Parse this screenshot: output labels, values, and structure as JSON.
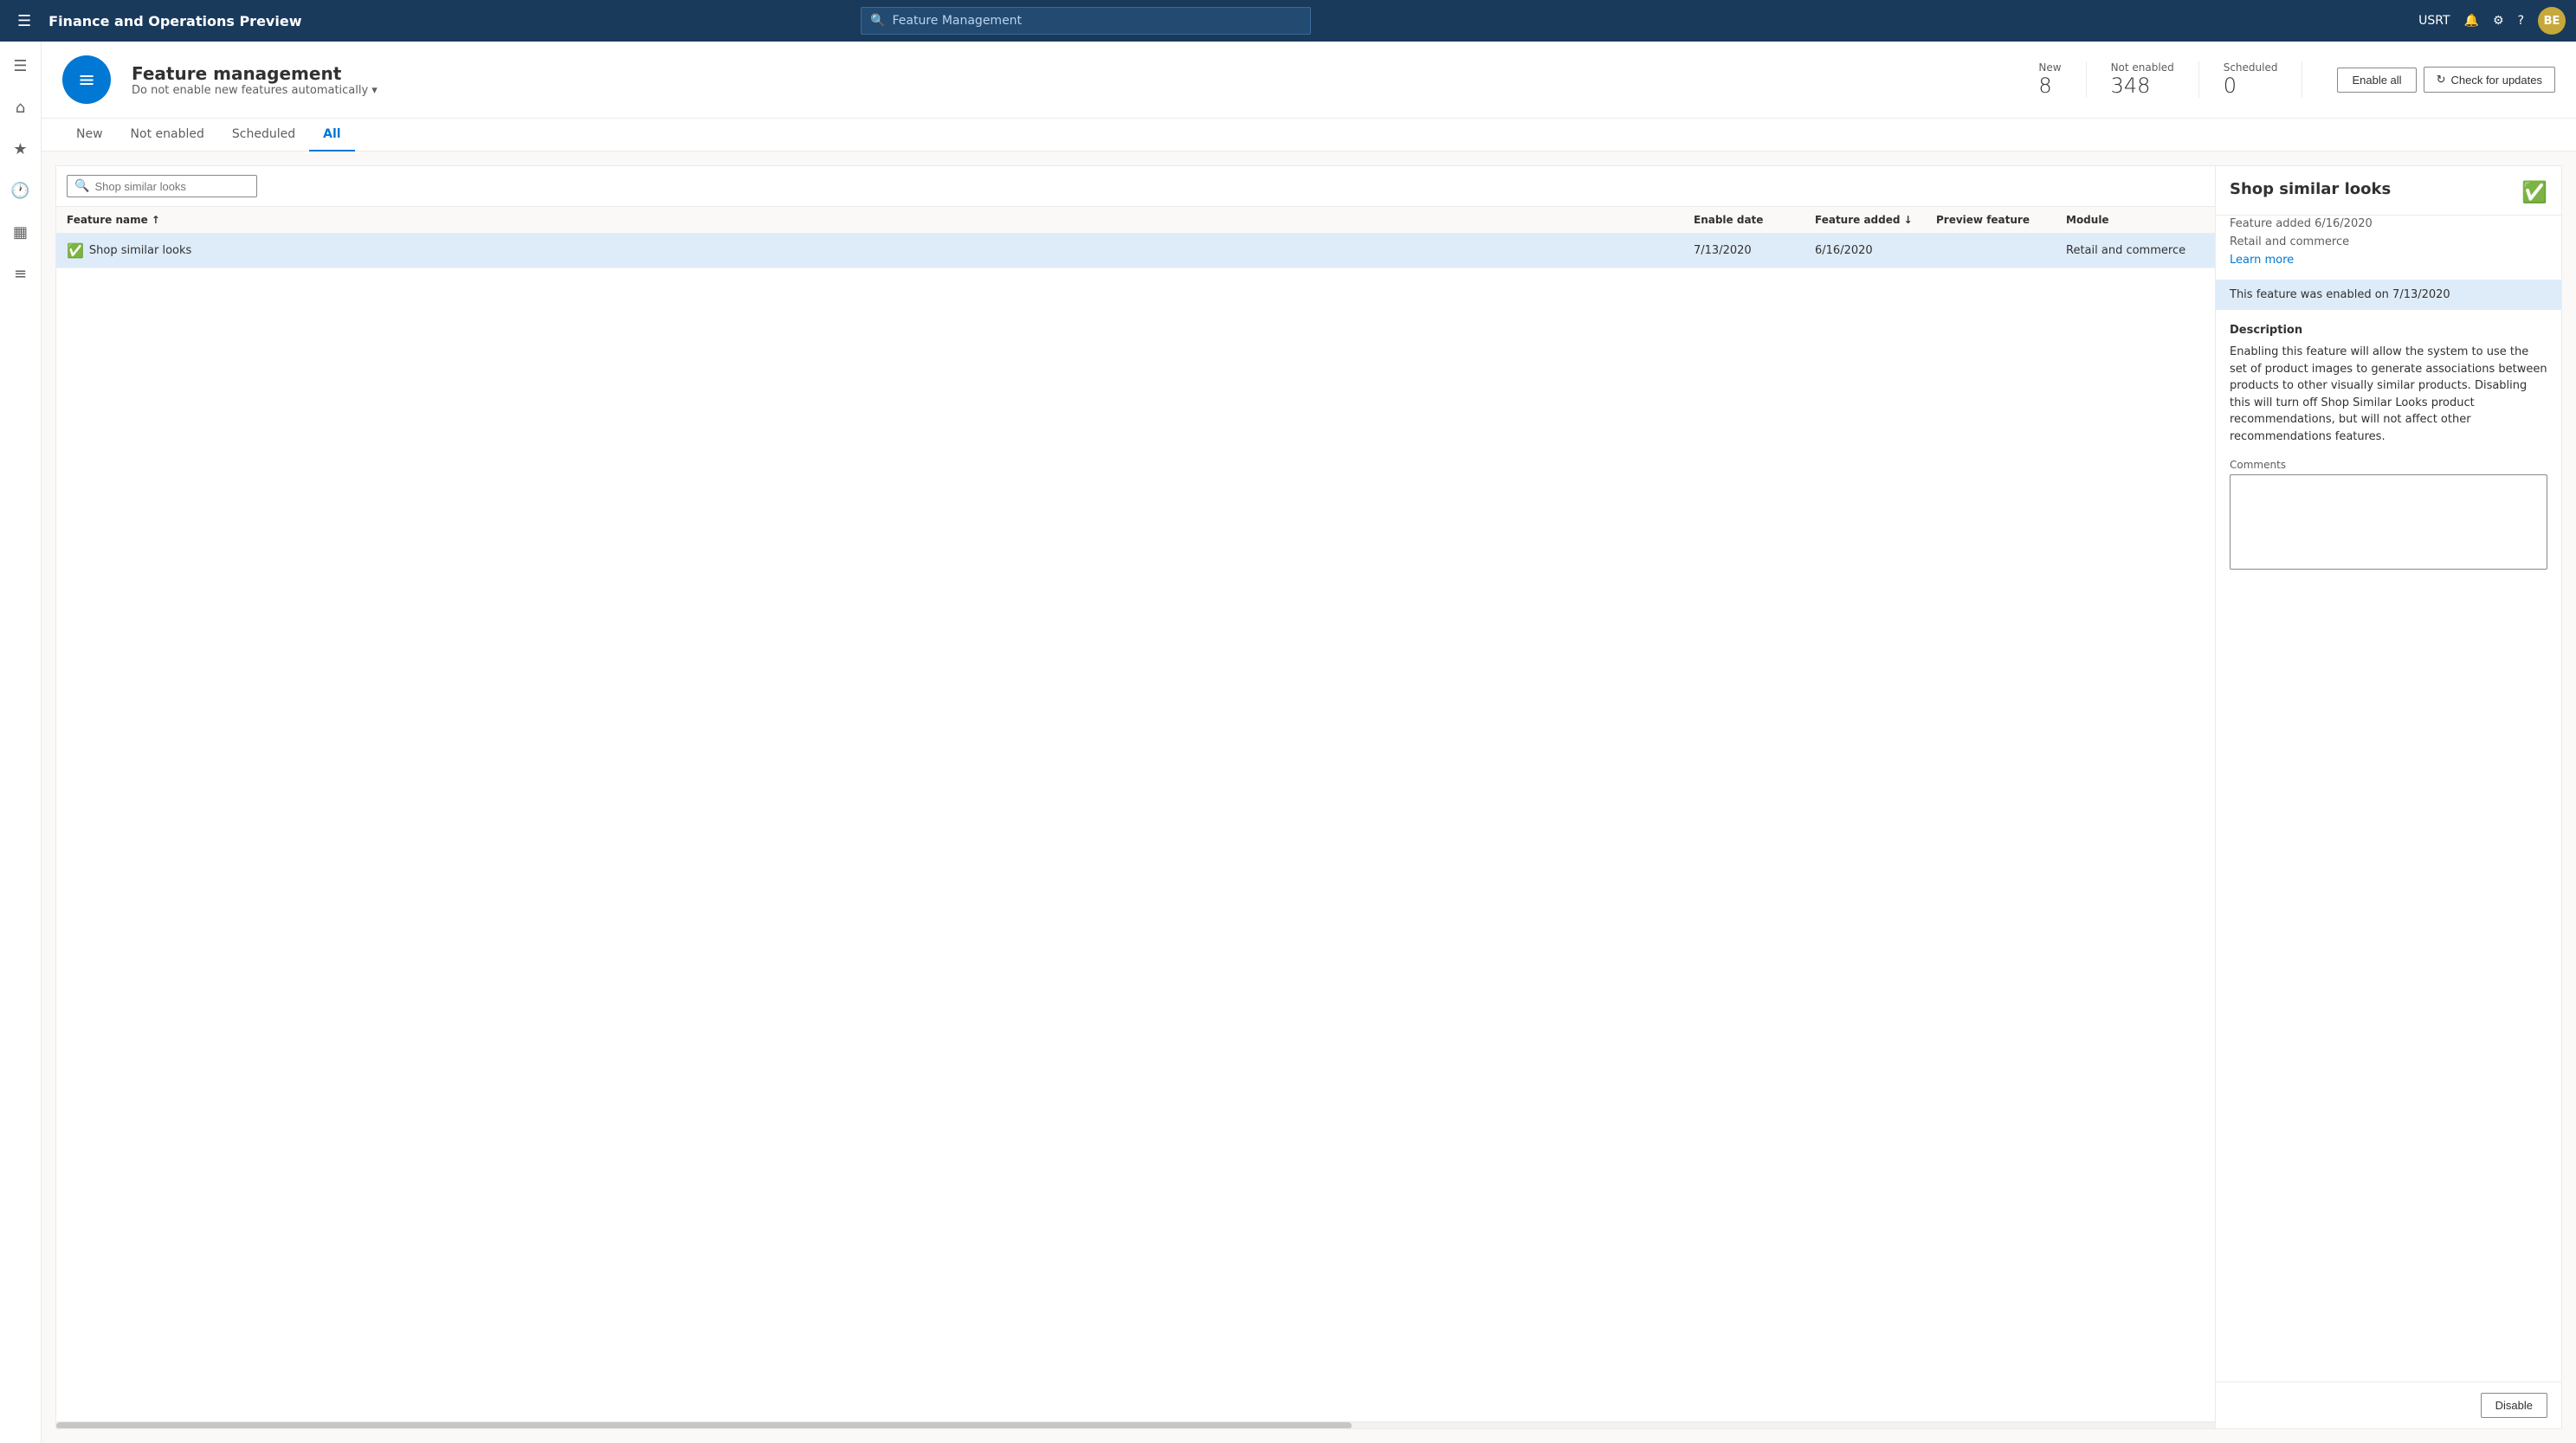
{
  "topbar": {
    "title": "Finance and Operations Preview",
    "search_placeholder": "Feature Management",
    "user_label": "USRT",
    "avatar_initials": "BE"
  },
  "page_header": {
    "icon_label": "list-icon",
    "title": "Feature management",
    "subtitle": "Do not enable new features automatically",
    "stats": [
      {
        "label": "New",
        "value": "8"
      },
      {
        "label": "Not enabled",
        "value": "348"
      },
      {
        "label": "Scheduled",
        "value": "0"
      }
    ],
    "btn_enable_all": "Enable all",
    "btn_check_updates": "Check for updates"
  },
  "tabs": [
    {
      "label": "New",
      "active": false
    },
    {
      "label": "Not enabled",
      "active": false
    },
    {
      "label": "Scheduled",
      "active": false
    },
    {
      "label": "All",
      "active": true
    }
  ],
  "table": {
    "search_placeholder": "Shop similar looks",
    "columns": [
      {
        "label": "Feature name",
        "sortable": true,
        "sort_dir": "asc"
      },
      {
        "label": "Enable date",
        "sortable": false
      },
      {
        "label": "Feature added",
        "sortable": true,
        "sort_dir": "desc"
      },
      {
        "label": "Preview feature",
        "sortable": false
      },
      {
        "label": "Module",
        "sortable": false
      }
    ],
    "rows": [
      {
        "name": "Shop similar looks",
        "enabled": true,
        "enable_date": "7/13/2020",
        "feature_added": "6/16/2020",
        "preview_feature": "",
        "module": "Retail and commerce",
        "selected": true
      }
    ]
  },
  "detail": {
    "title": "Shop similar looks",
    "feature_added": "Feature added 6/16/2020",
    "module": "Retail and commerce",
    "learn_more_label": "Learn more",
    "enabled_banner": "This feature was enabled on 7/13/2020",
    "description_title": "Description",
    "description": "Enabling this feature will allow the system to use the set of product images to generate associations between products to other visually similar products. Disabling this will turn off Shop Similar Looks product recommendations, but will not affect other recommendations features.",
    "comments_label": "Comments",
    "comments_value": "",
    "btn_disable": "Disable"
  },
  "sidebar": {
    "items": [
      {
        "icon": "☰",
        "name": "menu"
      },
      {
        "icon": "⌂",
        "name": "home"
      },
      {
        "icon": "★",
        "name": "favorites"
      },
      {
        "icon": "🕐",
        "name": "recent"
      },
      {
        "icon": "▦",
        "name": "workspaces"
      },
      {
        "icon": "≡",
        "name": "modules"
      }
    ]
  }
}
